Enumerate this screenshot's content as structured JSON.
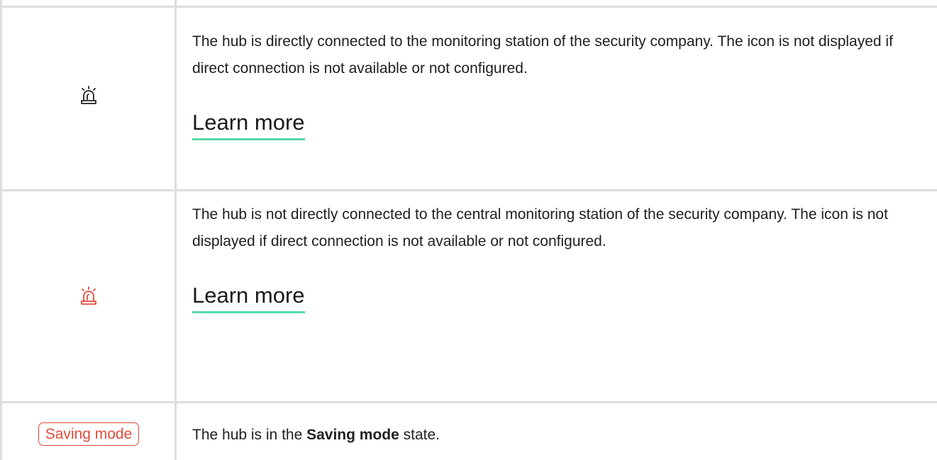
{
  "rows": [
    {
      "icon": "siren-icon",
      "icon_color": "#1f1f1f",
      "description": "The hub is directly connected to the monitoring station of the security company. The icon is not displayed if direct connection is not available or not configured.",
      "link_label": "Learn more"
    },
    {
      "icon": "siren-icon",
      "icon_color": "#e24a3b",
      "description": "The hub is not directly connected to the central monitoring station of the security company. The icon is not displayed if direct connection is not available or not configured.",
      "link_label": "Learn more"
    },
    {
      "badge_label": "Saving mode",
      "badge_color": "#e24a3b",
      "description_prefix": "The hub is in the ",
      "description_bold": "Saving mode",
      "description_suffix": " state."
    }
  ],
  "accent_underline_color": "#56dba6"
}
